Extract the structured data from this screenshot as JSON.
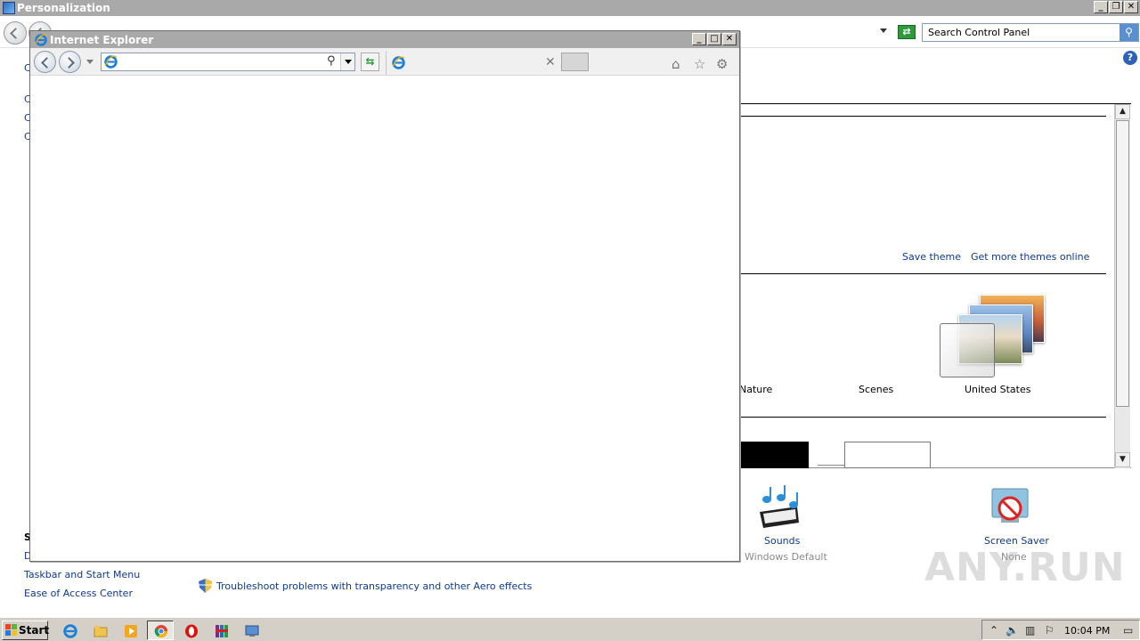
{
  "background_window": {
    "title": "Personalization",
    "search_placeholder": "Search Control Panel",
    "save_theme": "Save theme",
    "get_more_themes": "Get more themes online",
    "themes": [
      {
        "label": "Nature"
      },
      {
        "label": "Scenes"
      },
      {
        "label": "United States"
      }
    ],
    "sounds": {
      "title": "Sounds",
      "value": "Windows Default"
    },
    "screen_saver": {
      "title": "Screen Saver",
      "value": "None"
    },
    "see_also": {
      "taskbar": "Taskbar and Start Menu",
      "ease": "Ease of Access Center"
    },
    "troubleshoot": "Troubleshoot problems with transparency and other Aero effects",
    "left_fragments": [
      "C",
      "C",
      "C",
      "C",
      "S",
      "D"
    ]
  },
  "ie_window": {
    "title": "Internet Explorer",
    "address_value": ""
  },
  "taskbar": {
    "start_label": "Start",
    "clock": "10:04 PM"
  },
  "watermark": "ANY.RUN"
}
